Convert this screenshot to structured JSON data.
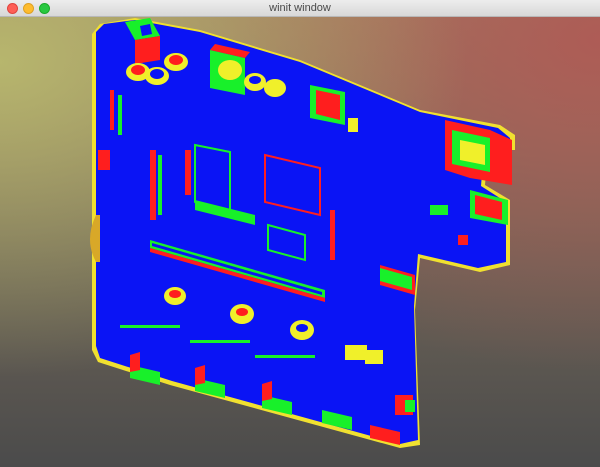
{
  "window": {
    "title": "winit window"
  },
  "colors": {
    "board": "#0a14f5",
    "face_red": "#ff1e1e",
    "face_green": "#18f02a",
    "face_yellow": "#f0f02a"
  },
  "icons": {
    "close": "close-button",
    "minimize": "minimize-button",
    "maximize": "maximize-button"
  }
}
